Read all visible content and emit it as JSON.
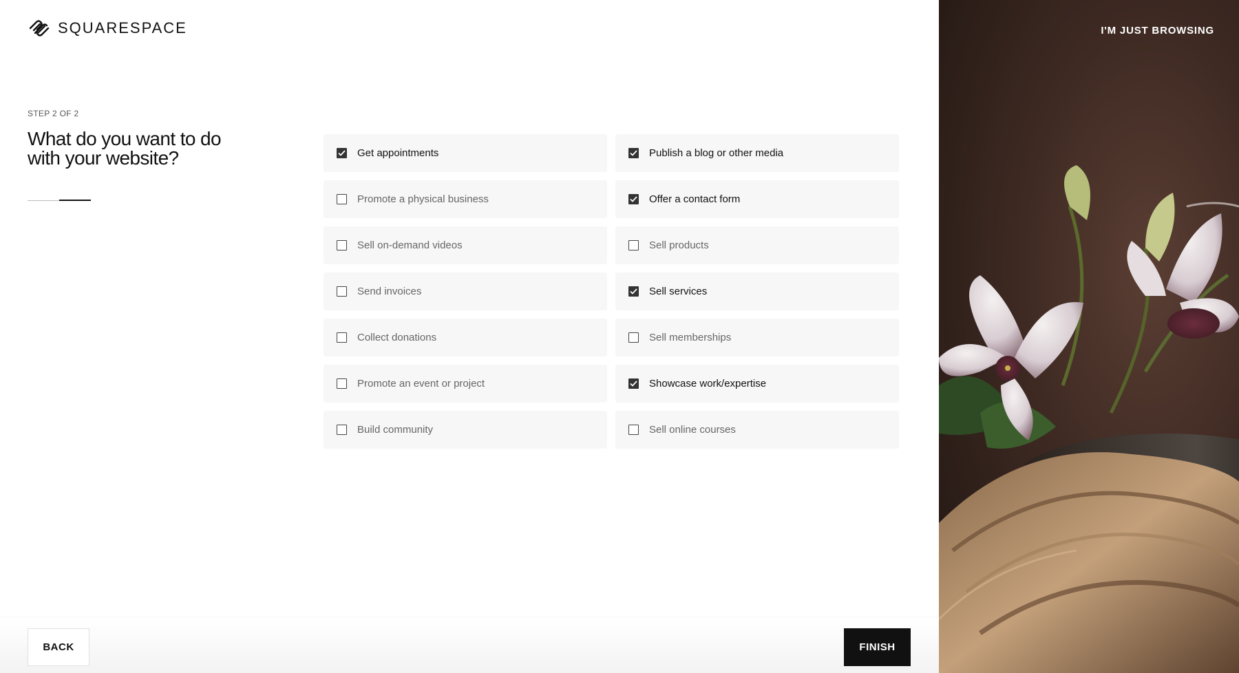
{
  "header": {
    "logo_text": "SQUARESPACE",
    "browsing_link": "I'M JUST BROWSING"
  },
  "main": {
    "step_label": "STEP 2 OF 2",
    "question": "What do you want to do with your website?",
    "progress": {
      "current_step": 2,
      "total_steps": 2
    }
  },
  "options": [
    {
      "label": "Get appointments",
      "checked": true
    },
    {
      "label": "Publish a blog or other media",
      "checked": true
    },
    {
      "label": "Promote a physical business",
      "checked": false
    },
    {
      "label": "Offer a contact form",
      "checked": true
    },
    {
      "label": "Sell on-demand videos",
      "checked": false
    },
    {
      "label": "Sell products",
      "checked": false
    },
    {
      "label": "Send invoices",
      "checked": false
    },
    {
      "label": "Sell services",
      "checked": true
    },
    {
      "label": "Collect donations",
      "checked": false
    },
    {
      "label": "Sell memberships",
      "checked": false
    },
    {
      "label": "Promote an event or project",
      "checked": false
    },
    {
      "label": "Showcase work/expertise",
      "checked": true
    },
    {
      "label": "Build community",
      "checked": false
    },
    {
      "label": "Sell online courses",
      "checked": false
    }
  ],
  "footer": {
    "back_label": "BACK",
    "finish_label": "FINISH"
  },
  "colors": {
    "accent": "#111111",
    "option_bg": "#f7f7f7",
    "checkbox_checked": "#333333"
  }
}
